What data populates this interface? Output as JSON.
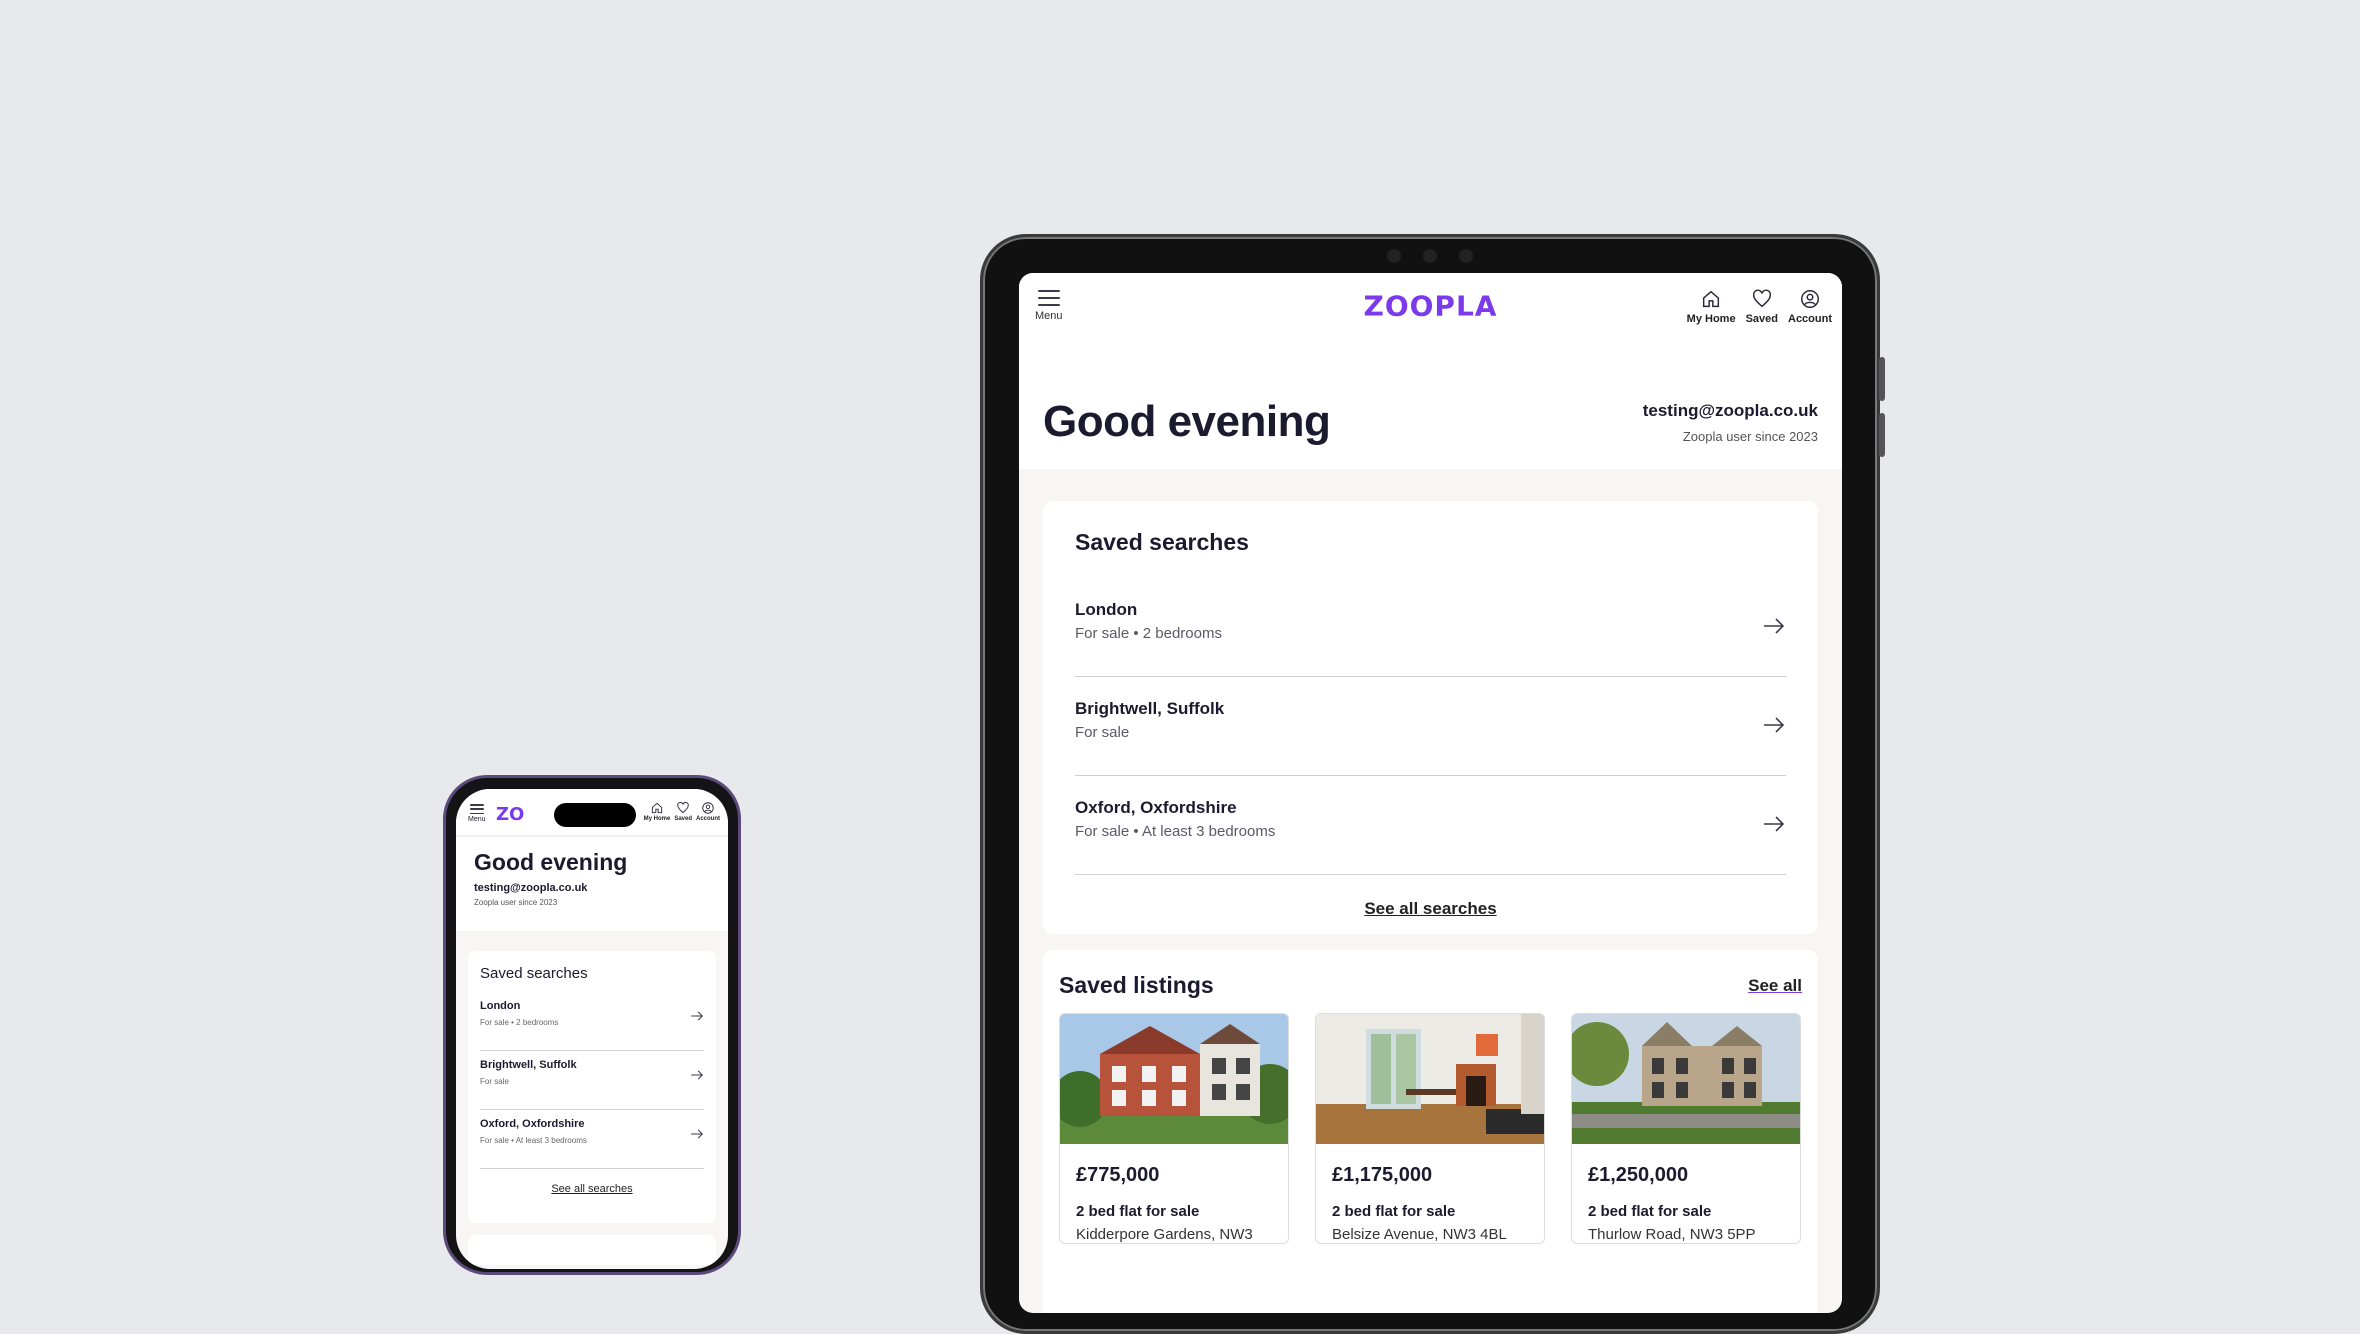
{
  "brand": {
    "logo": "ZOOPLA",
    "accent": "#7c3aed"
  },
  "header": {
    "menu_label": "Menu",
    "nav": [
      {
        "label": "My Home",
        "icon": "home-icon"
      },
      {
        "label": "Saved",
        "icon": "heart-icon"
      },
      {
        "label": "Account",
        "icon": "account-icon"
      }
    ]
  },
  "greeting": {
    "title": "Good evening",
    "email": "testing@zoopla.co.uk",
    "since": "Zoopla user since 2023"
  },
  "saved_searches": {
    "title": "Saved searches",
    "items": [
      {
        "location": "London",
        "details": "For sale • 2 bedrooms"
      },
      {
        "location": "Brightwell, Suffolk",
        "details": "For sale"
      },
      {
        "location": "Oxford, Oxfordshire",
        "details": "For sale • At least 3 bedrooms"
      }
    ],
    "see_all": "See all searches"
  },
  "saved_listings": {
    "title": "Saved listings",
    "see_all": "See all",
    "items": [
      {
        "price": "£775,000",
        "type": "2 bed flat for sale",
        "address": "Kidderpore Gardens, NW3"
      },
      {
        "price": "£1,175,000",
        "type": "2 bed flat for sale",
        "address": "Belsize Avenue, NW3 4BL"
      },
      {
        "price": "£1,250,000",
        "type": "2 bed flat for sale",
        "address": "Thurlow Road, NW3 5PP"
      }
    ]
  },
  "phone": {
    "logo_partial": "ZO"
  }
}
